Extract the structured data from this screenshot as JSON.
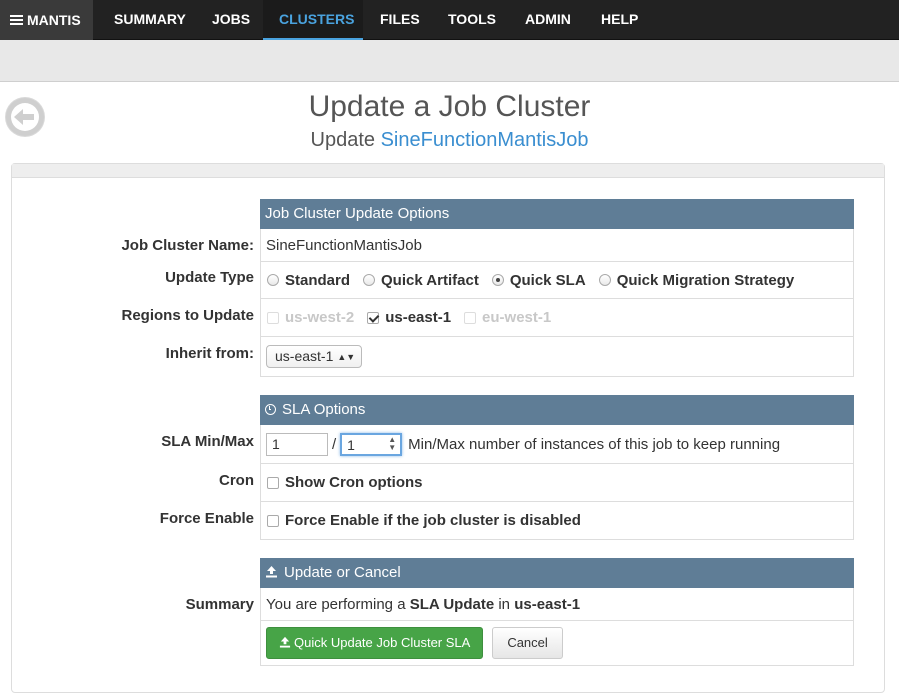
{
  "nav": {
    "brand": "MANTIS",
    "items": [
      {
        "label": "SUMMARY"
      },
      {
        "label": "JOBS"
      },
      {
        "label": "CLUSTERS"
      },
      {
        "label": "FILES"
      },
      {
        "label": "TOOLS"
      },
      {
        "label": "ADMIN"
      },
      {
        "label": "HELP"
      }
    ],
    "active": "CLUSTERS"
  },
  "page": {
    "title": "Update a Job Cluster",
    "subtitle_prefix": "Update",
    "subtitle_link": "SineFunctionMantisJob"
  },
  "update_options": {
    "header": "Job Cluster Update Options",
    "cluster_name_label": "Job Cluster Name:",
    "cluster_name": "SineFunctionMantisJob",
    "update_type_label": "Update Type",
    "update_types": [
      "Standard",
      "Quick Artifact",
      "Quick SLA",
      "Quick Migration Strategy"
    ],
    "update_type_selected": "Quick SLA",
    "regions_label": "Regions to Update",
    "regions": [
      "us-west-2",
      "us-east-1",
      "eu-west-1"
    ],
    "region_selected": "us-east-1",
    "inherit_label": "Inherit from:",
    "inherit_value": "us-east-1"
  },
  "sla_options": {
    "header": "SLA Options",
    "minmax_label": "SLA Min/Max",
    "min": "1",
    "separator": "/",
    "max": "1",
    "minmax_help": "Min/Max number of instances of this job to keep running",
    "cron_label": "Cron",
    "cron_option": "Show Cron options",
    "force_label": "Force Enable",
    "force_option": "Force Enable if the job cluster is disabled"
  },
  "update_cancel": {
    "header": "Update or Cancel",
    "summary_label": "Summary",
    "summary_prefix": "You are performing a",
    "summary_type": "SLA Update",
    "summary_in": "in",
    "summary_region": "us-east-1",
    "submit_label": "Quick Update Job Cluster SLA",
    "cancel_label": "Cancel"
  },
  "colors": {
    "nav_bg": "#222222",
    "active_link": "#4aa3df",
    "section_header": "#5f7d96",
    "submit_button": "#47a447"
  }
}
